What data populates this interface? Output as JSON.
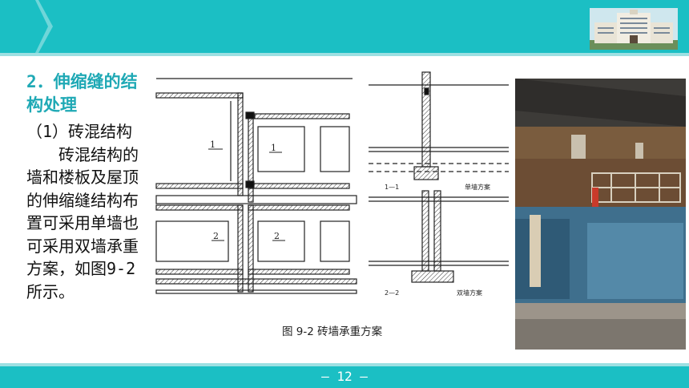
{
  "slide": {
    "section_title": "2．伸缩缝的结构处理",
    "subsection": "（1）砖混结构",
    "body": "砖混结构的墙和楼板及屋顶的伸缩缝结构布置可采用单墙也可采用双墙承重方案，如图9-2所示。",
    "page_number": "— 12 —"
  },
  "figure": {
    "caption": "图 9-2 砖墙承重方案",
    "plan_labels": [
      "1",
      "1",
      "2",
      "2"
    ],
    "section_labels": {
      "top_section": "1—1",
      "top_scheme": "单墙方案",
      "bottom_section": "2—2",
      "bottom_scheme": "双墙方案"
    }
  },
  "colors": {
    "header": "#1bbfc4",
    "title": "#1fa9b5"
  },
  "icons": {
    "header_logo": "building-photo-icon",
    "photo": "traditional-building-photo"
  }
}
